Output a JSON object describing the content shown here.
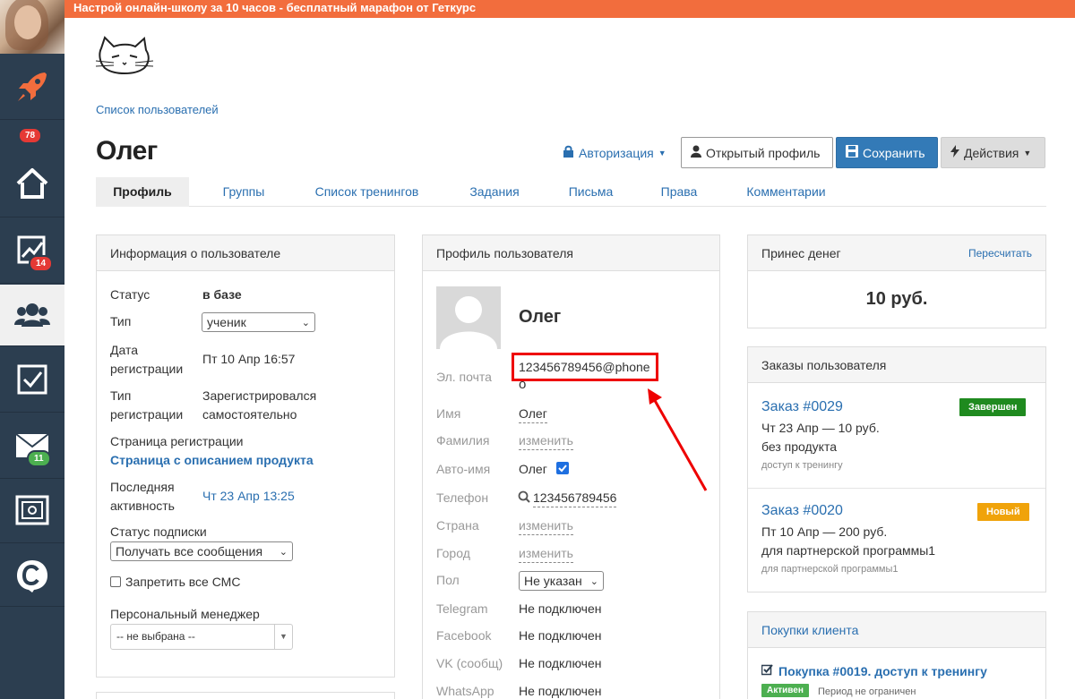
{
  "banner": {
    "text": "Настрой онлайн-школу за 10 часов - бесплатный марафон от Геткурс"
  },
  "sidebar": {
    "items": [
      {
        "icon": "rocket-icon",
        "badge": "78"
      },
      {
        "icon": "home-icon"
      },
      {
        "icon": "chart-icon",
        "badge": "14"
      },
      {
        "icon": "users-icon",
        "active": true
      },
      {
        "icon": "checkbox-icon"
      },
      {
        "icon": "mail-icon",
        "badge": "11"
      },
      {
        "icon": "safe-icon"
      },
      {
        "icon": "getcourse-logo-icon"
      }
    ]
  },
  "breadcrumb": "Список пользователей",
  "title": "Олег",
  "header": {
    "auth_label": "Авторизация",
    "profile_label": "Открытый профиль",
    "save_label": "Сохранить",
    "actions_label": "Действия"
  },
  "tabs": [
    "Профиль",
    "Группы",
    "Список тренингов",
    "Задания",
    "Письма",
    "Права",
    "Комментарии"
  ],
  "user_info": {
    "heading": "Информация о пользователе",
    "status_label": "Статус",
    "status_value": "в базе",
    "type_label": "Тип",
    "type_value": "ученик",
    "regdate_label_1": "Дата",
    "regdate_label_2": "регистрации",
    "regdate_value": "Пт 10 Апр 16:57",
    "regtype_label_1": "Тип",
    "regtype_label_2": "регистрации",
    "regtype_value_1": "Зарегистрировался",
    "regtype_value_2": "самостоятельно",
    "regpage_label": "Страница регистрации",
    "regpage_value": "Страница с описанием продукта",
    "lastact_label_1": "Последняя",
    "lastact_label_2": "активность",
    "lastact_value": "Чт 23 Апр 13:25",
    "subscription_label": "Статус подписки",
    "subscription_value": "Получать все сообщения",
    "sms_label": "Запретить все СМС",
    "manager_label": "Персональный менеджер",
    "manager_value": "-- не выбрана --"
  },
  "profile": {
    "heading": "Профиль пользователя",
    "name_big": "Олег",
    "email_label": "Эл. почта",
    "email_value": "123456789456@phone",
    "email_value_2": "o",
    "first_label": "Имя",
    "first_value": "Олег",
    "last_label": "Фамилия",
    "last_value": "изменить",
    "autoname_label": "Авто-имя",
    "autoname_value": "Олег",
    "phone_label": "Телефон",
    "phone_value": "123456789456",
    "country_label": "Страна",
    "country_value": "изменить",
    "city_label": "Город",
    "city_value": "изменить",
    "gender_label": "Пол",
    "gender_value": "Не указан",
    "telegram_label": "Telegram",
    "telegram_value": "Не подключен",
    "facebook_label": "Facebook",
    "facebook_value": "Не подключен",
    "vk_label": "VK (сообщ)",
    "vk_value": "Не подключен",
    "whatsapp_label": "WhatsApp",
    "whatsapp_value": "Не подключен"
  },
  "money": {
    "heading": "Принес денег",
    "recalc": "Пересчитать",
    "amount": "10 руб."
  },
  "orders": {
    "heading": "Заказы пользователя",
    "items": [
      {
        "title": "Заказ #0029",
        "status": "Завершен",
        "status_color": "#1f8a1f",
        "line1": "Чт 23 Апр — 10 руб.",
        "line2": "без продукта",
        "line3": "доступ к тренингу"
      },
      {
        "title": "Заказ #0020",
        "status": "Новый",
        "status_color": "#f0a30a",
        "line1": "Пт 10 Апр — 200 руб.",
        "line2": "для партнерской программы1",
        "line3": "для партнерской программы1"
      }
    ]
  },
  "purchases": {
    "heading": "Покупки клиента",
    "title": "Покупка #0019. доступ к тренингу",
    "status": "Активен",
    "period": "Период не ограничен"
  }
}
